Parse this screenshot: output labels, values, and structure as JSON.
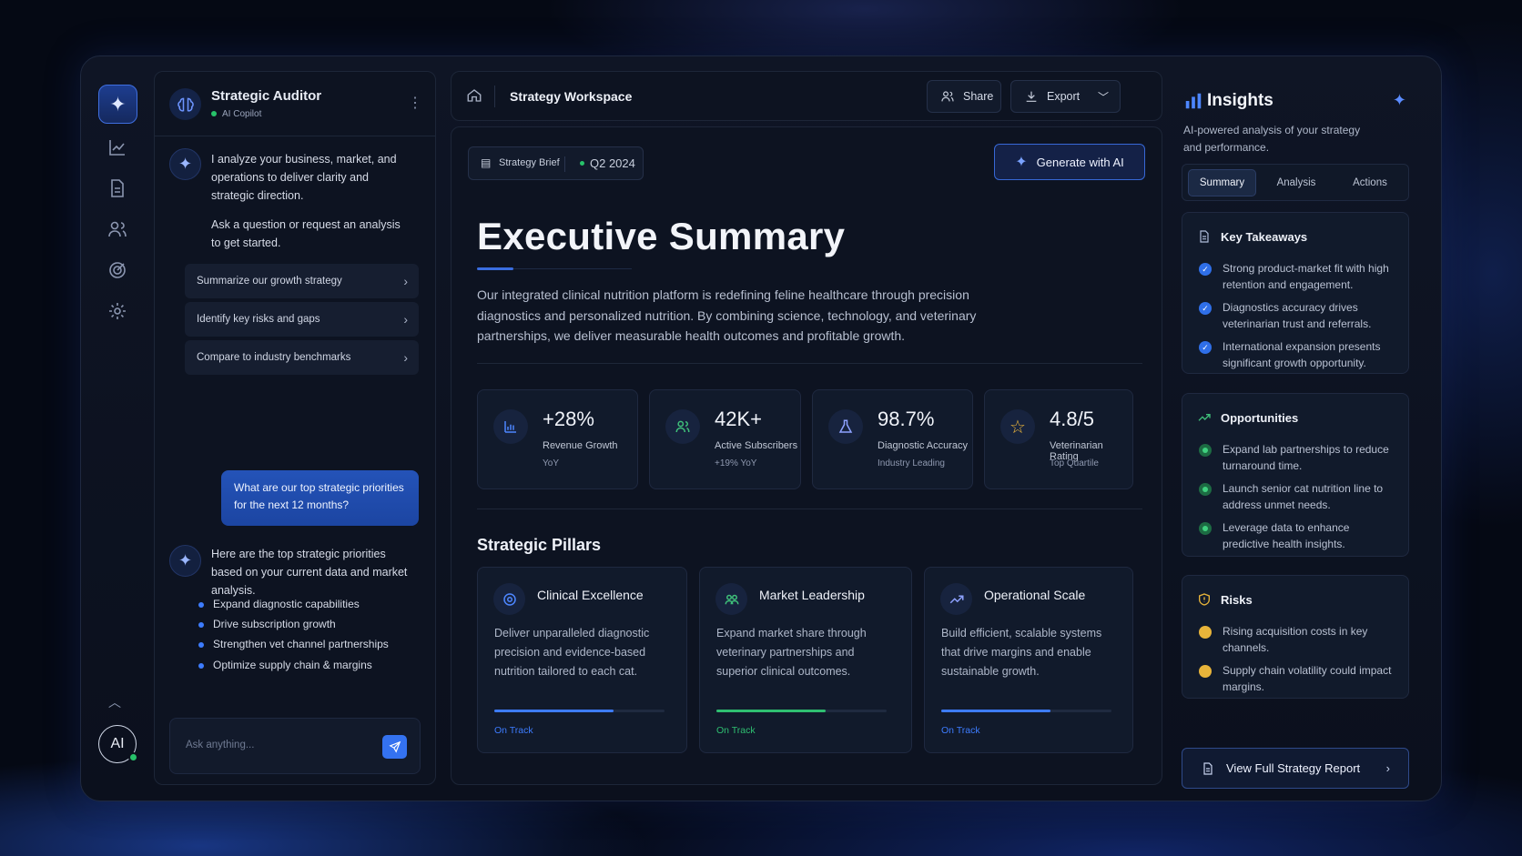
{
  "rail": {
    "logo_icon": "sparkle-icon",
    "items": [
      "chart-line-icon",
      "document-icon",
      "users-icon",
      "target-icon",
      "settings-gear-icon"
    ],
    "avatar": "AI"
  },
  "chat": {
    "title": "Strategic Auditor",
    "subtitle": "AI Copilot",
    "intro1": "I analyze your business, market, and operations to deliver clarity and strategic direction.",
    "intro2": "Ask a question or request an analysis to get started.",
    "suggestions": [
      "Summarize our growth strategy",
      "Identify key risks and gaps",
      "Compare to industry benchmarks"
    ],
    "user_message": "What are our top strategic priorities for the next 12 months?",
    "reply": "Here are the top strategic priorities based on your current data and market analysis.",
    "priorities": [
      "Expand diagnostic capabilities",
      "Drive subscription growth",
      "Strengthen vet channel partnerships",
      "Optimize supply chain & margins"
    ],
    "input_placeholder": "Ask anything..."
  },
  "topbar": {
    "title": "Strategy Workspace",
    "share": "Share",
    "export": "Export"
  },
  "main": {
    "brief": "Strategy Brief",
    "quarter": "Q2 2024",
    "generate": "Generate with AI",
    "heading": "Executive Summary",
    "summary": "Our integrated clinical nutrition platform is redefining feline healthcare through precision diagnostics and personalized nutrition. By combining science, technology, and veterinary partnerships, we deliver measurable health outcomes and profitable growth.",
    "stats": [
      {
        "value": "+28%",
        "label": "Revenue Growth",
        "sub": "YoY",
        "icon": "bar-chart-icon"
      },
      {
        "value": "42K+",
        "label": "Active Subscribers",
        "sub": "+19% YoY",
        "icon": "users-icon"
      },
      {
        "value": "98.7%",
        "label": "Diagnostic Accuracy",
        "sub": "Industry Leading",
        "icon": "flask-icon"
      },
      {
        "value": "4.8/5",
        "label": "Veterinarian Rating",
        "sub": "Top Quartile",
        "icon": "star-icon"
      }
    ],
    "pillars_heading": "Strategic Pillars",
    "pillars": [
      {
        "title": "Clinical Excellence",
        "desc": "Deliver unparalleled diagnostic precision and evidence-based nutrition tailored to each cat.",
        "status": "On Track",
        "progress": 0.7,
        "color": "#3d7cff",
        "icon": "target-icon"
      },
      {
        "title": "Market Leadership",
        "desc": "Expand market share through veterinary partnerships and superior clinical outcomes.",
        "status": "On Track",
        "progress": 0.64,
        "color": "#2fbf71",
        "icon": "users-icon"
      },
      {
        "title": "Operational Scale",
        "desc": "Build efficient, scalable systems that drive margins and enable sustainable growth.",
        "status": "On Track",
        "progress": 0.64,
        "color": "#3d7cff",
        "icon": "trend-up-icon"
      }
    ]
  },
  "insights": {
    "title": "Insights",
    "subtitle": "AI-powered analysis of your strategy and performance.",
    "tabs": [
      "Summary",
      "Analysis",
      "Actions"
    ],
    "takeaways_title": "Key Takeaways",
    "takeaways": [
      "Strong product-market fit with high retention and engagement.",
      "Diagnostics accuracy drives veterinarian trust and referrals.",
      "International expansion presents significant growth opportunity."
    ],
    "opportunities_title": "Opportunities",
    "opportunities": [
      "Expand lab partnerships to reduce turnaround time.",
      "Launch senior cat nutrition line to address unmet needs.",
      "Leverage data to enhance predictive health insights."
    ],
    "risks_title": "Risks",
    "risks": [
      "Rising acquisition costs in key channels.",
      "Supply chain volatility could impact margins."
    ],
    "report": "View Full Strategy Report",
    "colors": {
      "takeaway": "#2f6fe8",
      "opportunity": "#27b267",
      "risk": "#e8b43a"
    }
  }
}
